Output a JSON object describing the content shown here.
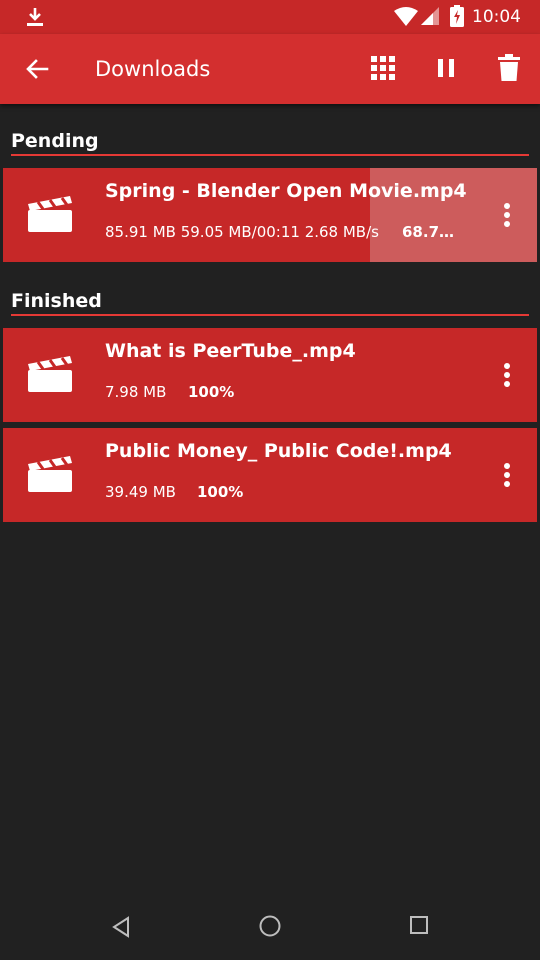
{
  "status_bar": {
    "time": "10:04",
    "icons": [
      "download-icon",
      "wifi-icon",
      "signal-icon",
      "battery-charging-icon"
    ]
  },
  "app_bar": {
    "title": "Downloads",
    "actions": [
      "back-arrow-icon",
      "grid-view-icon",
      "pause-icon",
      "trash-icon"
    ]
  },
  "sections": {
    "pending": {
      "label": "Pending",
      "items": [
        {
          "name": "Spring - Blender Open Movie.mp4",
          "meta": "85.91 MB  59.05 MB/00:11  2.68 MB/s",
          "percent": "68.7…",
          "progress": 0.687
        }
      ]
    },
    "finished": {
      "label": "Finished",
      "items": [
        {
          "name": "What is PeerTube_.mp4",
          "meta": "7.98 MB",
          "percent": "100%"
        },
        {
          "name": "Public Money_ Public Code!.mp4",
          "meta": "39.49 MB",
          "percent": "100%"
        }
      ]
    }
  },
  "colors": {
    "status_bar": "#c62828",
    "app_bar": "#d32f2f",
    "item_bg": "#c62828",
    "progress": "#cd5c5c",
    "background": "#212121"
  }
}
